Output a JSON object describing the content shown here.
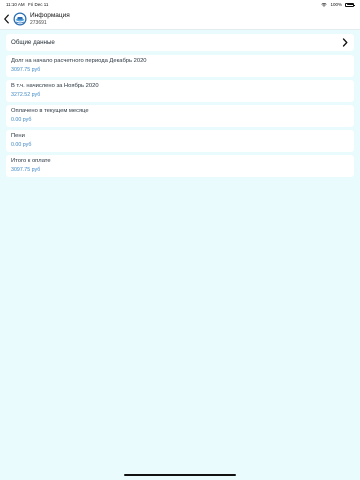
{
  "status_bar": {
    "time": "11:10 AM",
    "date": "Fri Dec 11",
    "battery": "100%",
    "battery_level": 1.0
  },
  "nav": {
    "title": "Информация",
    "subtitle": "273691"
  },
  "general": {
    "label": "Общие данные"
  },
  "rows": [
    {
      "label": "Долг на начало расчетного периода Декабрь 2020",
      "value": "3097.75 руб"
    },
    {
      "label": "В т.ч. начислено за Ноябрь 2020",
      "value": "3272.52 руб"
    },
    {
      "label": "Оплачено в текущем месяце",
      "value": "0.00 руб"
    },
    {
      "label": "Пени",
      "value": "0.00 руб"
    },
    {
      "label": "Итого к оплате",
      "value": "3097.75 руб"
    }
  ],
  "colors": {
    "background": "#e9fbfd",
    "value_text": "#3f88c5"
  }
}
